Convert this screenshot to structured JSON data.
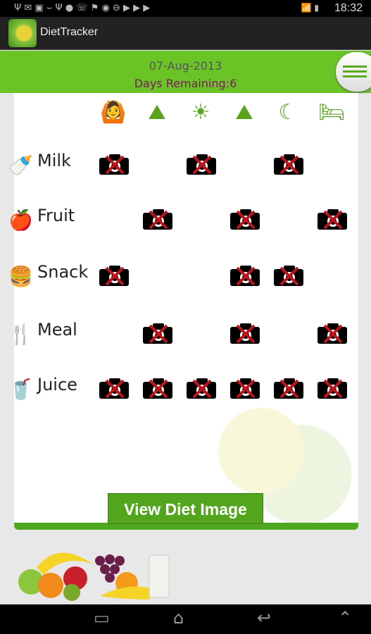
{
  "status_bar": {
    "time": "18:32",
    "notification_icons": [
      "usb-icon",
      "mail-icon",
      "image-icon",
      "plant-icon",
      "cutlery-icon",
      "fruit-icon",
      "missed-call-icon",
      "flag-icon",
      "bulb-icon",
      "block-icon",
      "store-icon",
      "store-icon",
      "store-icon"
    ],
    "system_icons": [
      "wifi-icon",
      "signal-icon",
      "battery-icon"
    ]
  },
  "app_bar": {
    "title": "DietTracker"
  },
  "header": {
    "date": "07-Aug-2013",
    "days_remaining": "Days Remaining:6"
  },
  "time_slots": [
    {
      "icon": "wake-up-icon",
      "glyph": "🙆"
    },
    {
      "icon": "sunrise-icon",
      "glyph": "⛰"
    },
    {
      "icon": "sun-icon",
      "glyph": "☀"
    },
    {
      "icon": "afternoon-icon",
      "glyph": "⛰"
    },
    {
      "icon": "evening-moon-icon",
      "glyph": "☾"
    },
    {
      "icon": "bed-icon",
      "glyph": "🛏"
    }
  ],
  "rows": [
    {
      "label": "Milk",
      "icon": "milk-bottle-icon",
      "glyph": "🍼",
      "slots": [
        true,
        false,
        true,
        false,
        true,
        false
      ]
    },
    {
      "label": "Fruit",
      "icon": "apple-icon",
      "glyph": "🍎",
      "slots": [
        false,
        true,
        false,
        true,
        false,
        true
      ]
    },
    {
      "label": "Snack",
      "icon": "burger-icon",
      "glyph": "🍔",
      "slots": [
        true,
        false,
        false,
        true,
        true,
        false
      ]
    },
    {
      "label": "Meal",
      "icon": "fork-knife-icon",
      "glyph": "🍴",
      "slots": [
        false,
        true,
        false,
        true,
        false,
        true
      ]
    },
    {
      "label": "Juice",
      "icon": "juice-cup-icon",
      "glyph": "🥤",
      "slots": [
        true,
        true,
        true,
        true,
        true,
        true
      ]
    }
  ],
  "view_button": "View Diet Image",
  "colors": {
    "accent": "#6ac426",
    "button": "#53a51e",
    "days_remaining": "#7a1a5c",
    "cross": "#c0141c"
  }
}
